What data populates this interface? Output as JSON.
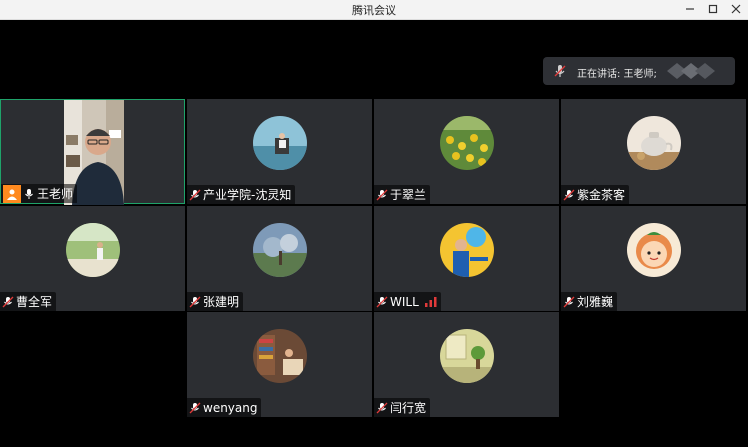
{
  "window": {
    "title": "腾讯会议"
  },
  "speaker": {
    "text": "正在讲话: 王老师;"
  },
  "participants": [
    {
      "name": "王老师"
    },
    {
      "name": "产业学院-沈灵知"
    },
    {
      "name": "于翠兰"
    },
    {
      "name": "紫金茶客"
    },
    {
      "name": "曹全军"
    },
    {
      "name": "张建明"
    },
    {
      "name": "WILL"
    },
    {
      "name": "刘雅巍"
    },
    {
      "name": "wenyang"
    },
    {
      "name": "闫行宽"
    }
  ],
  "colors": {
    "background": "#000000",
    "tile": "#2c2e32",
    "active_border": "#1fa36a",
    "host_badge": "#ff8a1f",
    "mic_muted": "#e03a3a"
  }
}
